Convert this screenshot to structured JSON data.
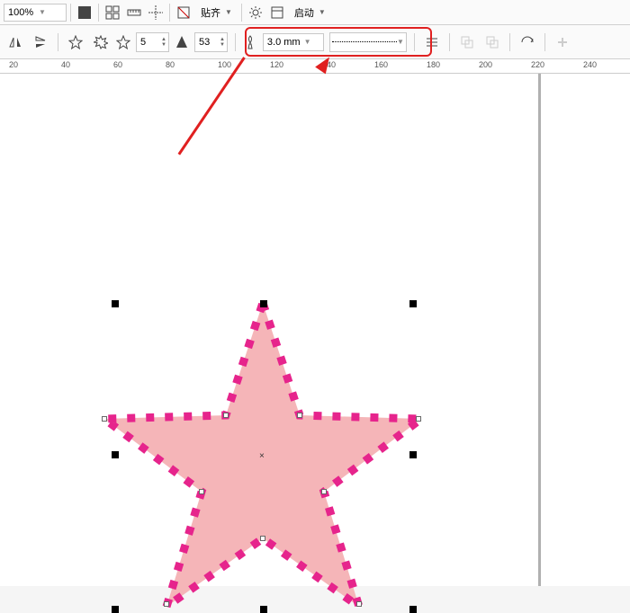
{
  "toolbar1": {
    "zoom": "100%",
    "snap_label": "贴齐",
    "launch_label": "启动"
  },
  "toolbar2": {
    "points_value": "5",
    "sharpness_value": "53",
    "outline_width": "3.0 mm"
  },
  "ruler": {
    "ticks": [
      "20",
      "40",
      "60",
      "80",
      "100",
      "120",
      "140",
      "160",
      "180",
      "200",
      "220",
      "240"
    ]
  },
  "canvas": {
    "shape_type": "star",
    "fill_color": "#f5b5b8",
    "stroke_color": "#e6248c",
    "points": 5
  }
}
